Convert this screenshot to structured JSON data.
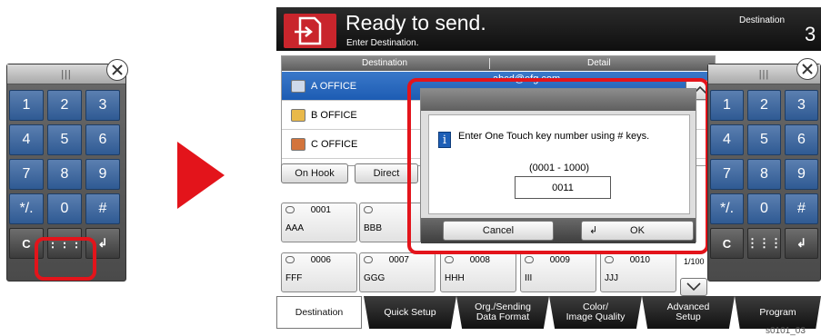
{
  "left_keypad": {
    "grip_label": "|||",
    "keys": [
      "1",
      "2",
      "3",
      "4",
      "5",
      "6",
      "7",
      "8",
      "9",
      "*/.",
      "0",
      "#",
      "C",
      "⋮⋮⋮",
      "↲"
    ]
  },
  "screen": {
    "title": "Ready to send.",
    "subtitle": "Enter Destination.",
    "destination_label": "Destination",
    "destination_count": "3",
    "list_header": {
      "destination": "Destination",
      "detail": "Detail"
    },
    "rows": [
      {
        "name": "A OFFICE",
        "detail": "abcd@efg.com",
        "selected": true
      },
      {
        "name": "B OFFICE",
        "detail": "",
        "selected": false
      },
      {
        "name": "C OFFICE",
        "detail": "",
        "selected": false
      }
    ],
    "on_hook": "On Hook",
    "direct": "Direct",
    "one_touch_row1": [
      {
        "num": "0001",
        "name": "AAA"
      },
      {
        "num": "",
        "name": "BBB"
      }
    ],
    "one_touch_row2": [
      {
        "num": "0006",
        "name": "FFF"
      },
      {
        "num": "0007",
        "name": "GGG"
      },
      {
        "num": "0008",
        "name": "HHH"
      },
      {
        "num": "0009",
        "name": "III"
      },
      {
        "num": "0010",
        "name": "JJJ"
      }
    ],
    "page_indicator": "1/100",
    "tabs": [
      "Destination",
      "Quick Setup",
      "Org./Sending\nData Format",
      "Color/\nImage Quality",
      "Advanced\nSetup",
      "Program"
    ]
  },
  "dialog": {
    "message": "Enter One Touch key number using # keys.",
    "range": "(0001 - 1000)",
    "value": "0011",
    "cancel": "Cancel",
    "ok": "OK",
    "ok_icon": "↲"
  },
  "right_keypad": {
    "grip_label": "|||",
    "keys": [
      "1",
      "2",
      "3",
      "4",
      "5",
      "6",
      "7",
      "8",
      "9",
      "*/.",
      "0",
      "#",
      "C",
      "⋮⋮⋮",
      "↲"
    ]
  },
  "caption": "s0101_03",
  "colors": {
    "highlight": "#e3141b",
    "selected_row": "#2a6abf",
    "header_icon": "#c9252c"
  }
}
